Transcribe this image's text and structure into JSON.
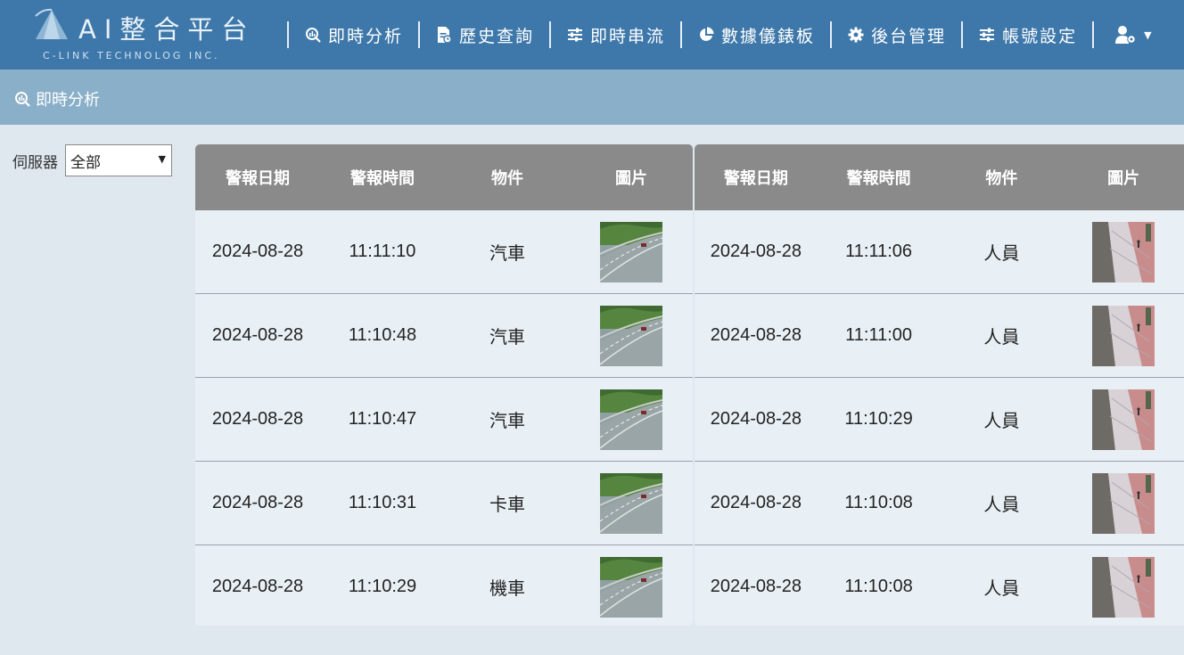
{
  "header": {
    "logo_title": "AI整合平台",
    "logo_subtitle": "C-LINK TECHNOLOG INC.",
    "nav": [
      {
        "label": "即時分析",
        "icon": "analysis-icon"
      },
      {
        "label": "歷史查詢",
        "icon": "history-doc-icon"
      },
      {
        "label": "即時串流",
        "icon": "sliders-icon"
      },
      {
        "label": "數據儀錶板",
        "icon": "pie-chart-icon"
      },
      {
        "label": "後台管理",
        "icon": "gear-icon"
      },
      {
        "label": "帳號設定",
        "icon": "sliders-icon"
      }
    ],
    "user_icon": "user-settings-icon"
  },
  "breadcrumb": {
    "label": "即時分析",
    "icon": "analysis-icon"
  },
  "filter": {
    "label": "伺服器",
    "selected": "全部"
  },
  "tables": {
    "columns": [
      "警報日期",
      "警報時間",
      "物件",
      "圖片"
    ],
    "left": [
      {
        "date": "2024-08-28",
        "time": "11:11:10",
        "object": "汽車",
        "image": "highway-camera-thumbnail"
      },
      {
        "date": "2024-08-28",
        "time": "11:10:48",
        "object": "汽車",
        "image": "highway-camera-thumbnail"
      },
      {
        "date": "2024-08-28",
        "time": "11:10:47",
        "object": "汽車",
        "image": "highway-camera-thumbnail"
      },
      {
        "date": "2024-08-28",
        "time": "11:10:31",
        "object": "卡車",
        "image": "highway-camera-thumbnail"
      },
      {
        "date": "2024-08-28",
        "time": "11:10:29",
        "object": "機車",
        "image": "highway-camera-thumbnail"
      }
    ],
    "right": [
      {
        "date": "2024-08-28",
        "time": "11:11:06",
        "object": "人員",
        "image": "sidewalk-camera-thumbnail"
      },
      {
        "date": "2024-08-28",
        "time": "11:11:00",
        "object": "人員",
        "image": "sidewalk-camera-thumbnail"
      },
      {
        "date": "2024-08-28",
        "time": "11:10:29",
        "object": "人員",
        "image": "sidewalk-camera-thumbnail"
      },
      {
        "date": "2024-08-28",
        "time": "11:10:08",
        "object": "人員",
        "image": "sidewalk-camera-thumbnail"
      },
      {
        "date": "2024-08-28",
        "time": "11:10:08",
        "object": "人員",
        "image": "sidewalk-camera-thumbnail"
      }
    ]
  },
  "colors": {
    "navbar": "#3e78aa",
    "subbar": "#8aafc8",
    "table_header": "#8a8a8a",
    "table_body": "#e9f0f5",
    "page_bg": "#dfe8ef"
  }
}
